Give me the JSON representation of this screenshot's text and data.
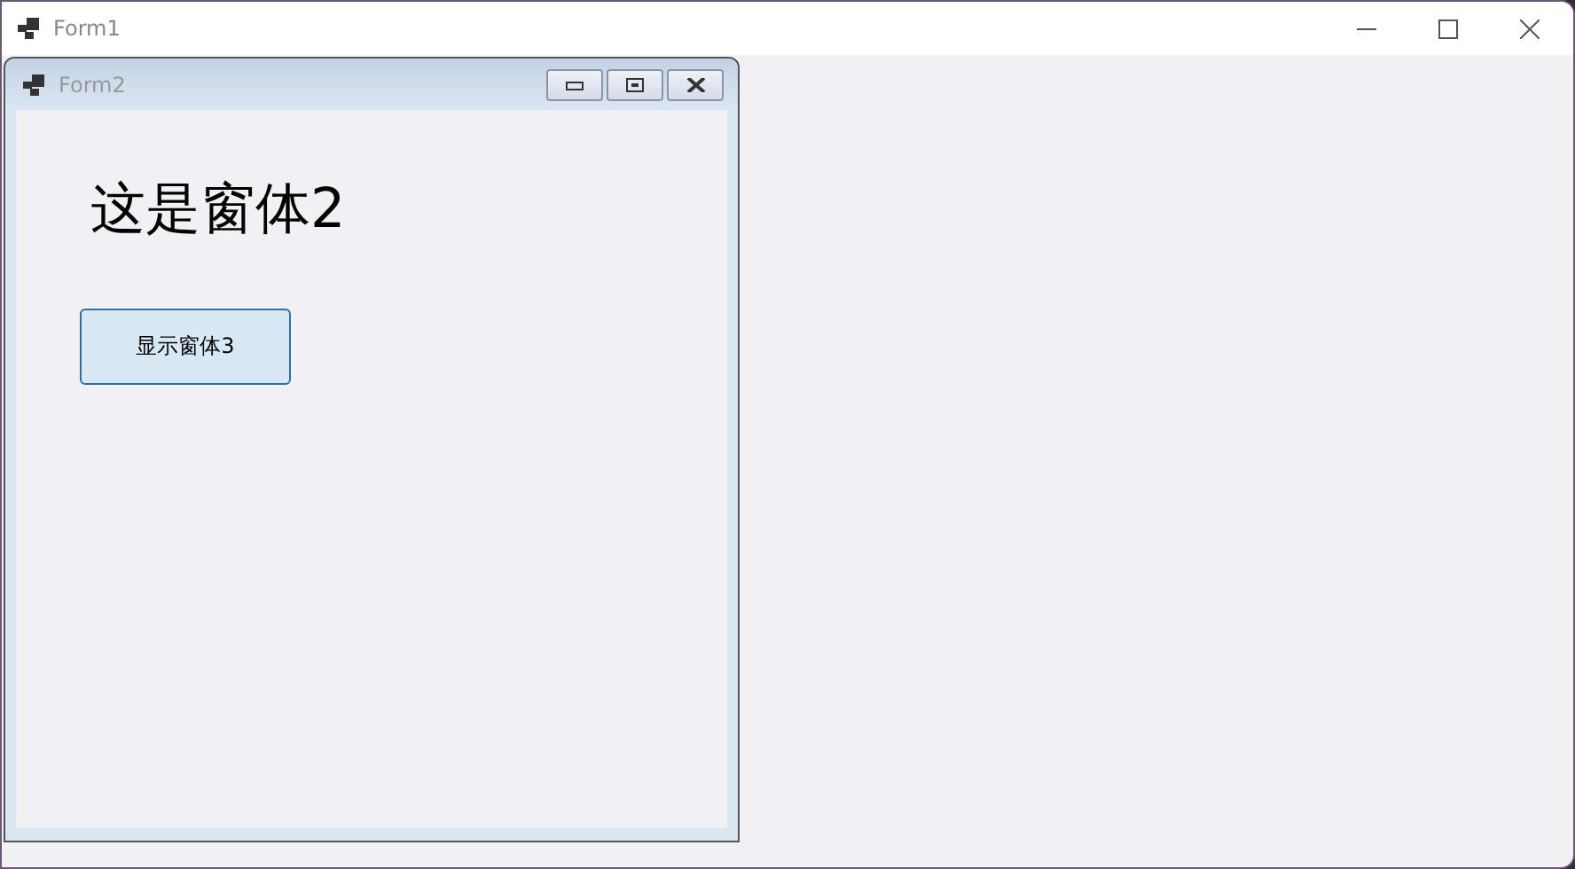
{
  "window": {
    "title": "Form1"
  },
  "child_window": {
    "title": "Form2",
    "heading": "这是窗体2",
    "button": "显示窗体3"
  }
}
